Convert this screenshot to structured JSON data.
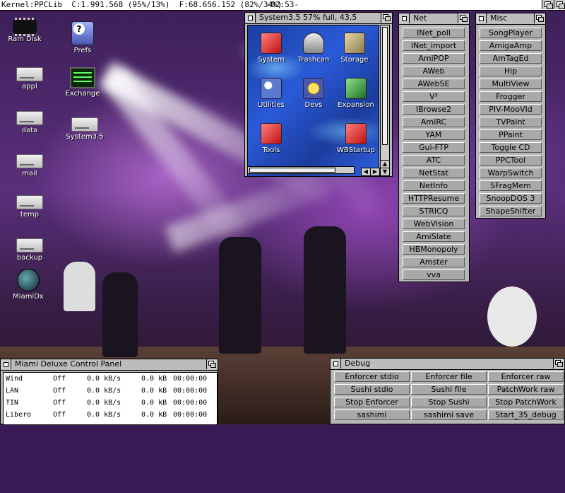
{
  "topbar": {
    "status": "Kernel:PPCLib  C:1.991.568 (95%/13%)  F:68.656.152 (82%/34%)",
    "clock": "-02:53-"
  },
  "desktop_icons": [
    {
      "label": "Ram Disk",
      "icon": "ram-disk-icon"
    },
    {
      "label": "Prefs",
      "icon": "prefs-drawer-icon"
    },
    {
      "label": "appl",
      "icon": "hard-drive-icon"
    },
    {
      "label": "Exchange",
      "icon": "exchange-icon"
    },
    {
      "label": "data",
      "icon": "hard-drive-icon"
    },
    {
      "label": "System3.5",
      "icon": "system-drive-icon"
    },
    {
      "label": "mail",
      "icon": "hard-drive-icon"
    },
    {
      "label": "temp",
      "icon": "hard-drive-icon"
    },
    {
      "label": "backup",
      "icon": "hard-drive-icon"
    },
    {
      "label": "MiamiDx",
      "icon": "miami-icon"
    }
  ],
  "system_window": {
    "title": "System3.5  57% full, 43,5",
    "icons": [
      {
        "label": "System"
      },
      {
        "label": "Trashcan"
      },
      {
        "label": "Storage"
      },
      {
        "label": "Utilities"
      },
      {
        "label": "Devs"
      },
      {
        "label": "Expansion"
      },
      {
        "label": "Tools"
      },
      {
        "label": "WBStartup"
      }
    ]
  },
  "net_window": {
    "title": "Net",
    "buttons": [
      "INet_poll",
      "INet_import",
      "AmiPOP",
      "AWeb",
      "AWebSE",
      "V³",
      "IBrowse2",
      "AmIRC",
      "YAM",
      "Gui-FTP",
      "ATC",
      "NetStat",
      "NetInfo",
      "HTTPResume",
      "STRICQ",
      "WebVision",
      "AmiSlate",
      "HBMonopoly",
      "Amster",
      "vva"
    ]
  },
  "misc_window": {
    "title": "Misc",
    "buttons": [
      "SongPlayer",
      "AmigaAmp",
      "AmTagEd",
      "Hip",
      "MultiView",
      "Frogger",
      "PIV-MooVId",
      "TVPaint",
      "PPaint",
      "Toggle CD",
      "PPCTool",
      "WarpSwitch",
      "SFragMem",
      "SnoopDOS 3",
      "ShapeShifter"
    ]
  },
  "miami_window": {
    "title": "Miami Deluxe Control Panel",
    "rows": [
      {
        "name": "Wind",
        "state": "Off",
        "rate": "0.0 kB/s",
        "total": "0.0 kB",
        "time": "00:00:00"
      },
      {
        "name": "LAN",
        "state": "Off",
        "rate": "0.0 kB/s",
        "total": "0.0 kB",
        "time": "00:00:00"
      },
      {
        "name": "TIN",
        "state": "Off",
        "rate": "0.0 kB/s",
        "total": "0.0 kB",
        "time": "00:00:00"
      },
      {
        "name": "Libero",
        "state": "Off",
        "rate": "0.0 kB/s",
        "total": "0.0 kB",
        "time": "00:00:00"
      }
    ]
  },
  "debug_window": {
    "title": "Debug",
    "buttons": [
      "Enforcer stdio",
      "Enforcer file",
      "Enforcer raw",
      "Sushi stdio",
      "Sushi file",
      "PatchWork raw",
      "Stop Enforcer",
      "Stop Sushi",
      "Stop PatchWork",
      "sashimi",
      "sashimi save",
      "Start_35_debug"
    ]
  }
}
